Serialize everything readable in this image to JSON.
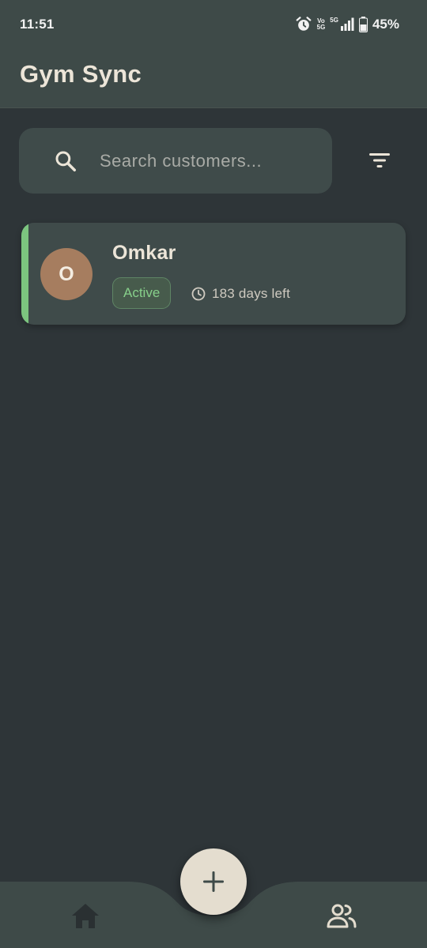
{
  "status_bar": {
    "time": "11:51",
    "volte_top": "Vo",
    "volte_bottom": "5G",
    "network": "5G",
    "battery": "45%"
  },
  "app_bar": {
    "title": "Gym Sync"
  },
  "search": {
    "placeholder": "Search customers...",
    "value": ""
  },
  "customers": [
    {
      "initial": "O",
      "name": "Omkar",
      "status": "Active",
      "days_left": "183 days left",
      "accent_color": "#7cc47f",
      "avatar_color": "#a67d5f"
    }
  ],
  "nav": {
    "items": [
      {
        "icon": "home-icon"
      },
      {
        "icon": "people-icon"
      }
    ],
    "fab_icon": "plus-icon"
  },
  "colors": {
    "background": "#2e3538",
    "surface": "#3e4a48",
    "accent_active": "#7cc47f",
    "fab": "#e4ddcf"
  }
}
